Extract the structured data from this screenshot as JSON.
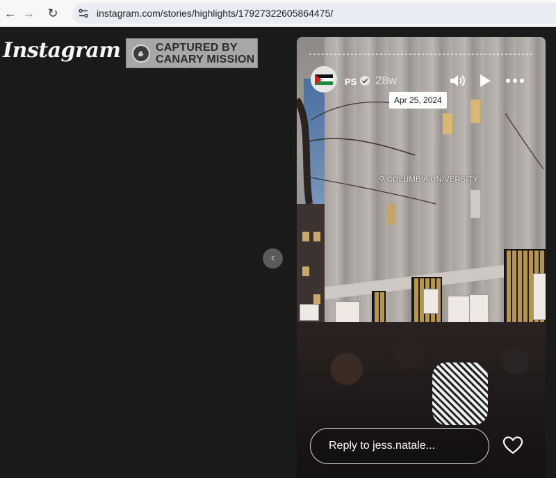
{
  "browser": {
    "url": "instagram.com/stories/highlights/17927322605864475/",
    "back_icon": "←",
    "forward_icon": "→",
    "reload_icon": "↻"
  },
  "page": {
    "logo": "Instagram",
    "watermark": {
      "line1": "CAPTURED BY",
      "line2": "CANARY MISSION"
    },
    "prev_icon": "‹"
  },
  "story": {
    "username": "PS",
    "age": "28w",
    "date_tooltip": "Apr 25, 2024",
    "location": "COLUMBIA UNIVERSITY",
    "reply_placeholder": "Reply to jess.natale...",
    "icons": {
      "sound": "speaker-icon",
      "play": "play-icon",
      "more": "more-icon",
      "like": "heart-icon"
    }
  }
}
